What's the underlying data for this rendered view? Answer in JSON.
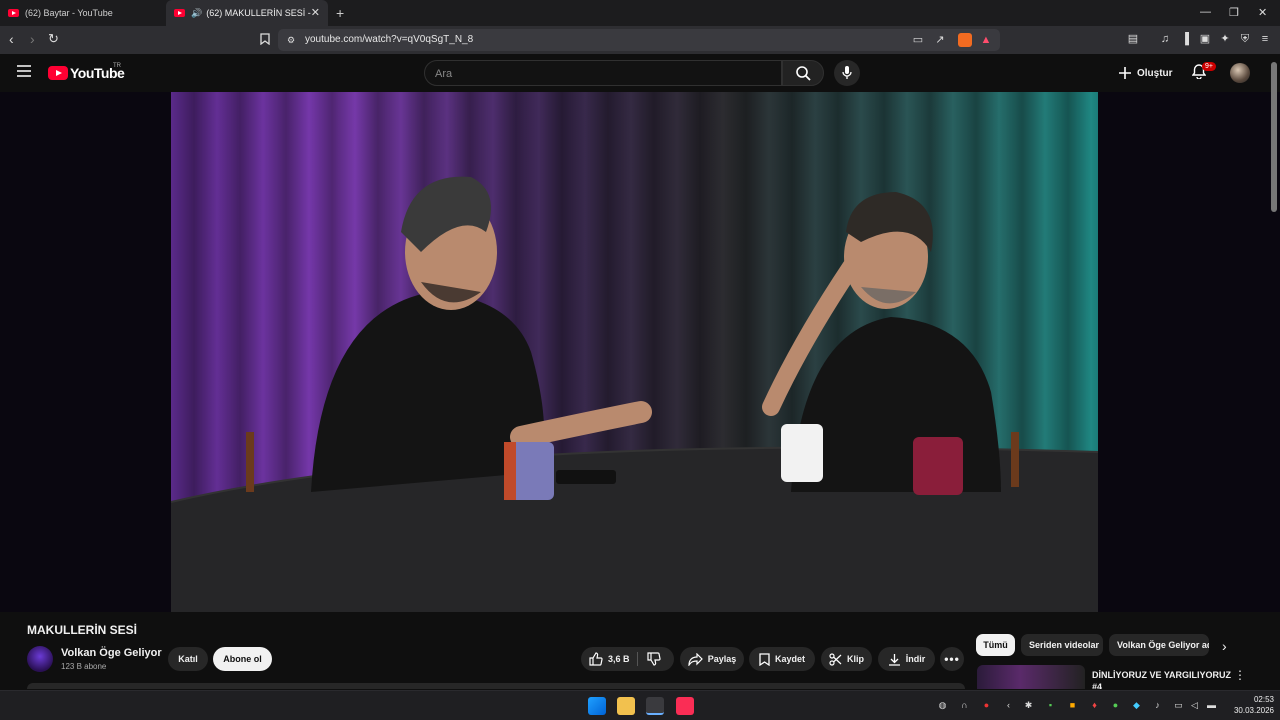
{
  "browser": {
    "tabs": [
      {
        "title": "(62) Baytar - YouTube",
        "active": false
      },
      {
        "title": "(62) MAKULLERİN SESİ - YouT",
        "active": true
      }
    ],
    "url": "youtube.com/watch?v=qV0qSgT_N_8"
  },
  "header": {
    "logo_text": "YouTube",
    "country_code": "TR",
    "search_placeholder": "Ara",
    "create_label": "Oluştur",
    "notification_count": "9+"
  },
  "video": {
    "title": "MAKULLERİN SESİ",
    "channel_name": "Volkan Öge Geliyor",
    "subscribers": "123 B abone",
    "join_label": "Katıl",
    "subscribe_label": "Abone ol",
    "like_count": "3,6 B",
    "share_label": "Paylaş",
    "save_label": "Kaydet",
    "clip_label": "Klip",
    "download_label": "İndir"
  },
  "sidebar": {
    "chips": [
      {
        "label": "Tümü",
        "selected": true
      },
      {
        "label": "Seriden videolar",
        "selected": false
      },
      {
        "label": "Volkan Öge Geliyor ad",
        "selected": false
      }
    ],
    "recommendation_title": "DİNLİYORUZ VE YARGILIYORUZ #4"
  },
  "taskbar": {
    "time": "02:53",
    "date": "30.03.2026"
  },
  "colors": {
    "accent": "#ff0033",
    "background": "#0f0f0f",
    "pill": "#272727"
  }
}
